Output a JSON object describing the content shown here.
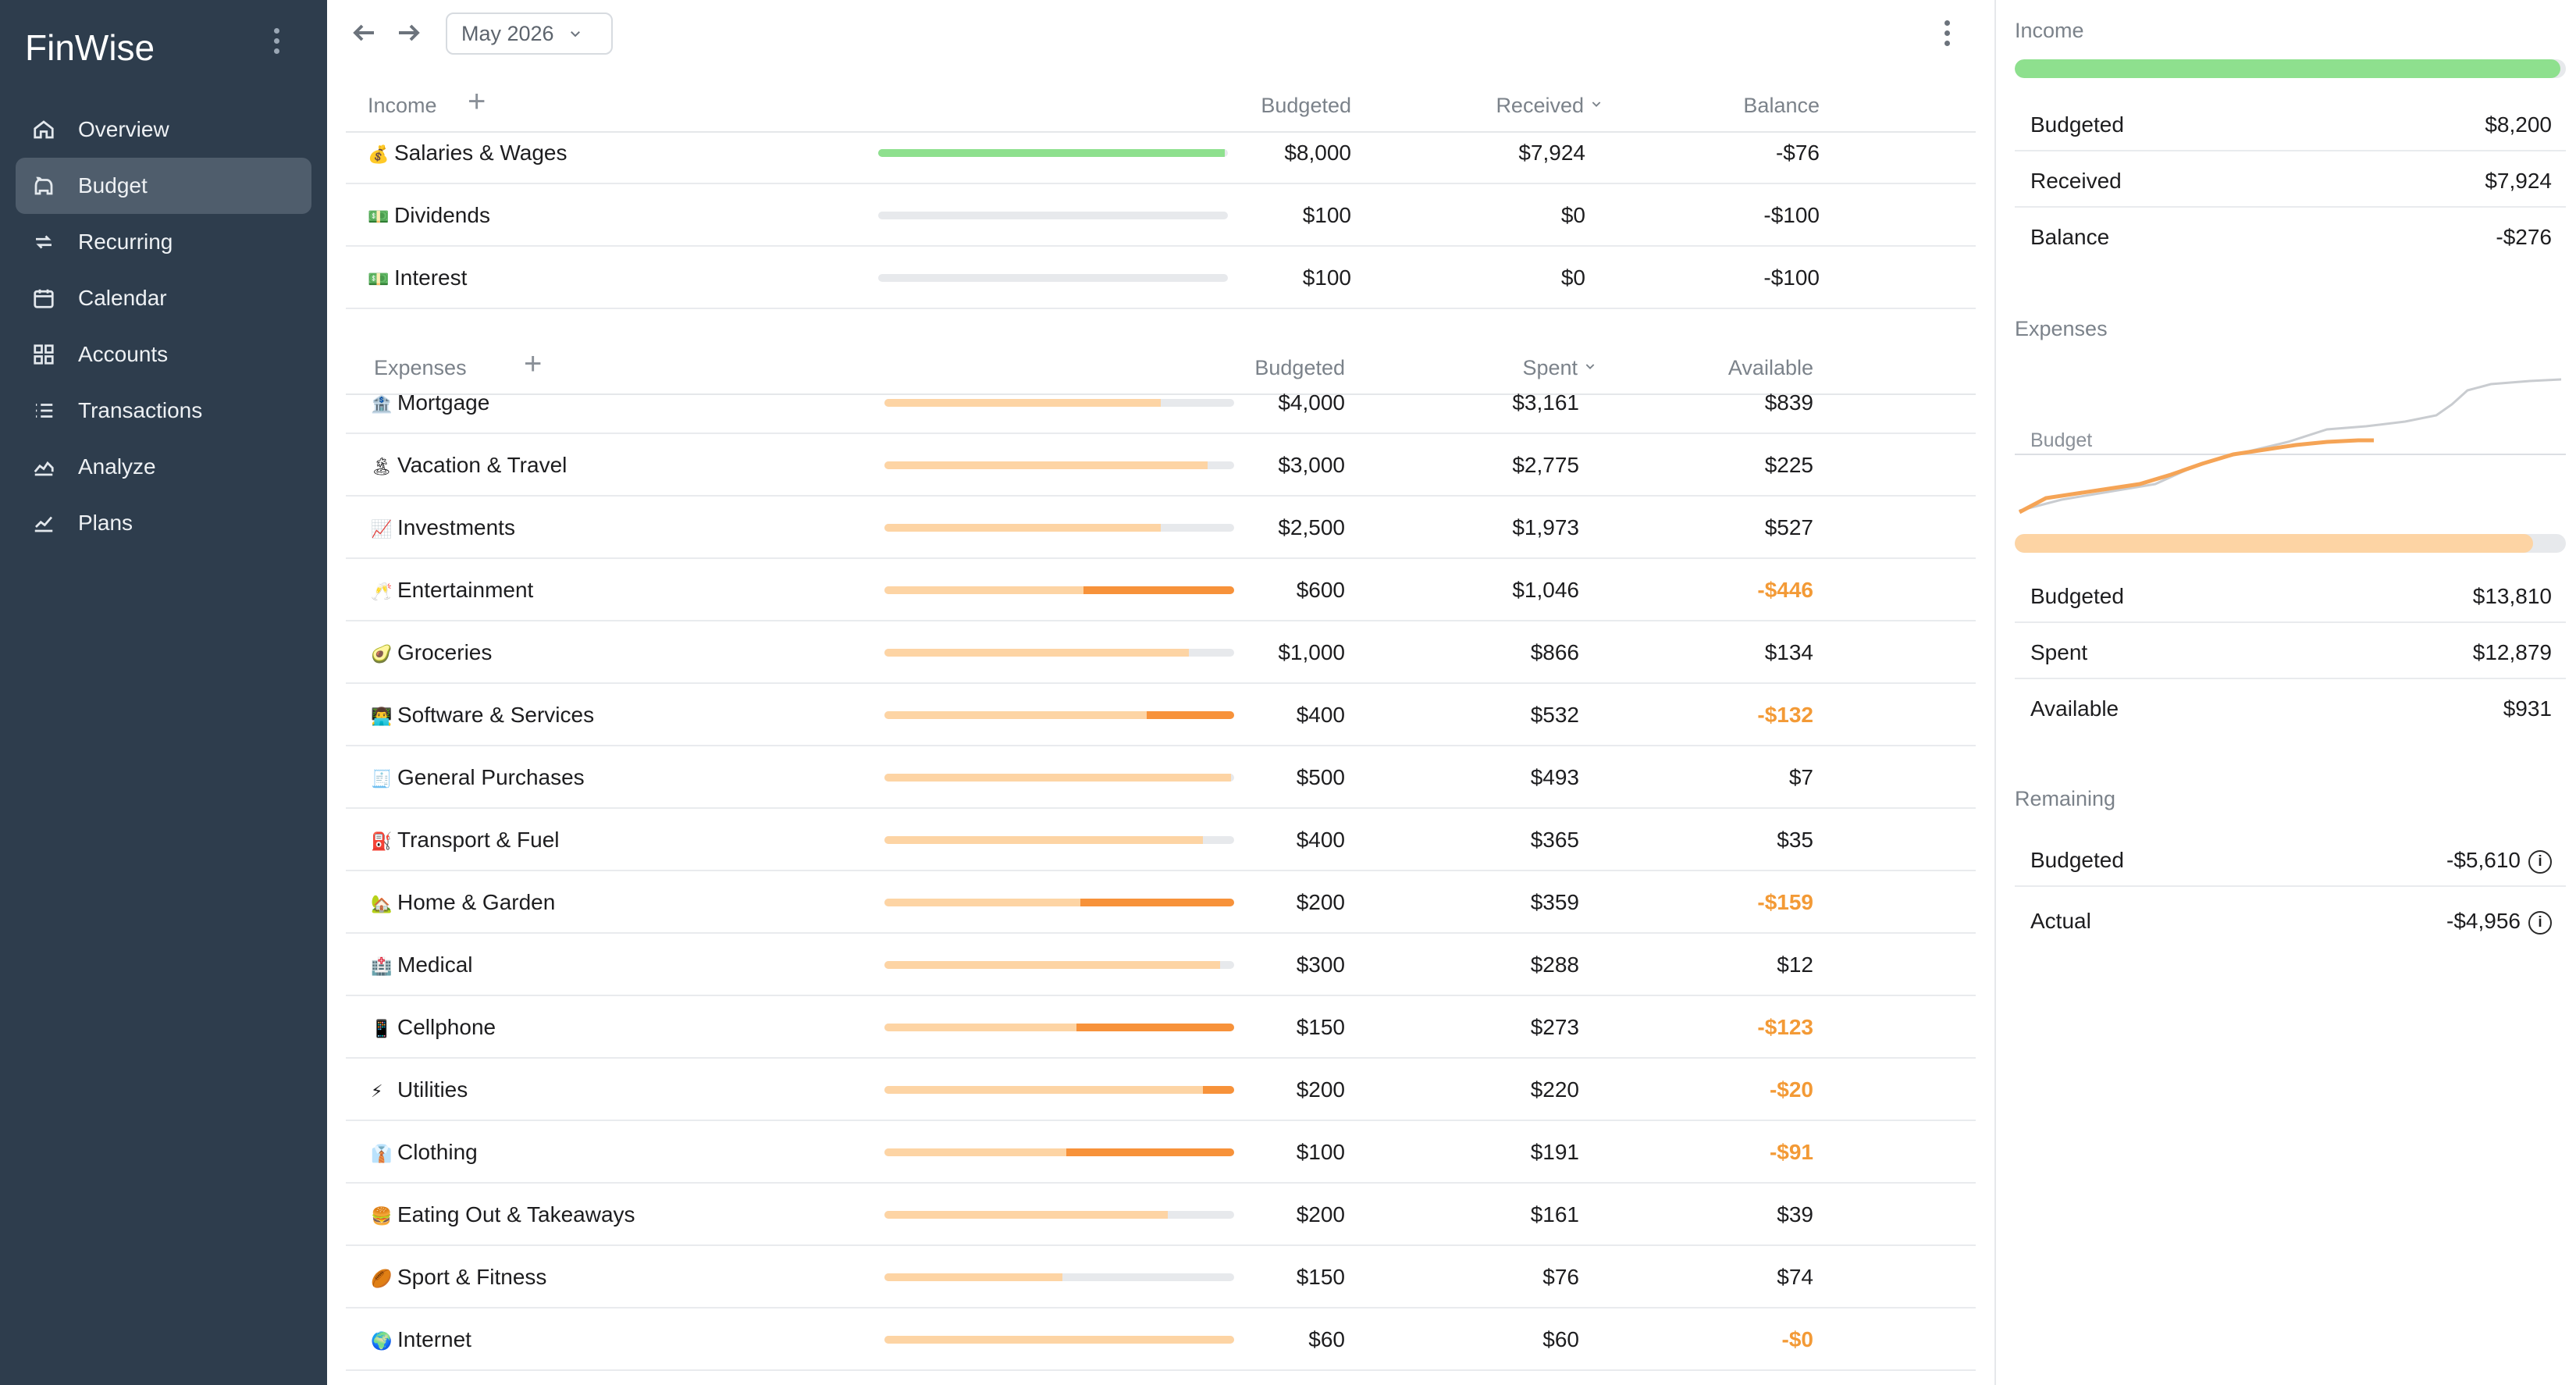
{
  "app": {
    "name": "FinWise",
    "nav": [
      {
        "label": "Overview",
        "icon": "home-icon"
      },
      {
        "label": "Budget",
        "icon": "piggy-bank-icon",
        "active": true
      },
      {
        "label": "Recurring",
        "icon": "repeat-icon"
      },
      {
        "label": "Calendar",
        "icon": "calendar-icon"
      },
      {
        "label": "Accounts",
        "icon": "grid-icon"
      },
      {
        "label": "Transactions",
        "icon": "list-icon"
      },
      {
        "label": "Analyze",
        "icon": "chart-area-icon"
      },
      {
        "label": "Plans",
        "icon": "chart-line-icon"
      }
    ]
  },
  "toolbar": {
    "month": "May 2026"
  },
  "income": {
    "label": "Income",
    "columns": [
      "Budgeted",
      "Received",
      "Balance"
    ],
    "rows": [
      {
        "emoji": "💰",
        "name": "Salaries & Wages",
        "budgeted": "$8,000",
        "received": "$7,924",
        "balance": "-$76",
        "progress": 0.99,
        "over": 0,
        "negative": false
      },
      {
        "emoji": "💵",
        "name": "Dividends",
        "budgeted": "$100",
        "received": "$0",
        "balance": "-$100",
        "progress": 0,
        "over": 0,
        "negative": false
      },
      {
        "emoji": "💵",
        "name": "Interest",
        "budgeted": "$100",
        "received": "$0",
        "balance": "-$100",
        "progress": 0,
        "over": 0,
        "negative": false
      }
    ]
  },
  "expenses": {
    "label": "Expenses",
    "columns": [
      "Budgeted",
      "Spent",
      "Available"
    ],
    "rows": [
      {
        "emoji": "🏦",
        "name": "Mortgage",
        "budgeted": "$4,000",
        "spent": "$3,161",
        "available": "$839",
        "progress": 0.79,
        "over": 0,
        "negative": false
      },
      {
        "emoji": "🏝",
        "name": "Vacation & Travel",
        "budgeted": "$3,000",
        "spent": "$2,775",
        "available": "$225",
        "progress": 0.925,
        "over": 0,
        "negative": false
      },
      {
        "emoji": "📈",
        "name": "Investments",
        "budgeted": "$2,500",
        "spent": "$1,973",
        "available": "$527",
        "progress": 0.79,
        "over": 0,
        "negative": false
      },
      {
        "emoji": "🥂",
        "name": "Entertainment",
        "budgeted": "$600",
        "spent": "$1,046",
        "available": "-$446",
        "progress": 0.57,
        "over": 0.43,
        "negative": true
      },
      {
        "emoji": "🥑",
        "name": "Groceries",
        "budgeted": "$1,000",
        "spent": "$866",
        "available": "$134",
        "progress": 0.87,
        "over": 0,
        "negative": false
      },
      {
        "emoji": "👨‍💻",
        "name": "Software & Services",
        "budgeted": "$400",
        "spent": "$532",
        "available": "-$132",
        "progress": 0.75,
        "over": 0.25,
        "negative": true
      },
      {
        "emoji": "🧾",
        "name": "General Purchases",
        "budgeted": "$500",
        "spent": "$493",
        "available": "$7",
        "progress": 0.99,
        "over": 0,
        "negative": false
      },
      {
        "emoji": "⛽",
        "name": "Transport & Fuel",
        "budgeted": "$400",
        "spent": "$365",
        "available": "$35",
        "progress": 0.91,
        "over": 0,
        "negative": false
      },
      {
        "emoji": "🏡",
        "name": "Home & Garden",
        "budgeted": "$200",
        "spent": "$359",
        "available": "-$159",
        "progress": 0.56,
        "over": 0.44,
        "negative": true
      },
      {
        "emoji": "🏥",
        "name": "Medical",
        "budgeted": "$300",
        "spent": "$288",
        "available": "$12",
        "progress": 0.96,
        "over": 0,
        "negative": false
      },
      {
        "emoji": "📱",
        "name": "Cellphone",
        "budgeted": "$150",
        "spent": "$273",
        "available": "-$123",
        "progress": 0.55,
        "over": 0.45,
        "negative": true
      },
      {
        "emoji": "⚡",
        "name": "Utilities",
        "budgeted": "$200",
        "spent": "$220",
        "available": "-$20",
        "progress": 0.91,
        "over": 0.09,
        "negative": true
      },
      {
        "emoji": "👔",
        "name": "Clothing",
        "budgeted": "$100",
        "spent": "$191",
        "available": "-$91",
        "progress": 0.52,
        "over": 0.48,
        "negative": true
      },
      {
        "emoji": "🍔",
        "name": "Eating Out & Takeaways",
        "budgeted": "$200",
        "spent": "$161",
        "available": "$39",
        "progress": 0.81,
        "over": 0,
        "negative": false
      },
      {
        "emoji": "🏉",
        "name": "Sport & Fitness",
        "budgeted": "$150",
        "spent": "$76",
        "available": "$74",
        "progress": 0.51,
        "over": 0,
        "negative": false
      },
      {
        "emoji": "🌍",
        "name": "Internet",
        "budgeted": "$60",
        "spent": "$60",
        "available": "-$0",
        "progress": 1.0,
        "over": 0,
        "negative": true
      }
    ]
  },
  "summary": {
    "income": {
      "title": "Income",
      "progress": 0.99,
      "rows": [
        {
          "label": "Budgeted",
          "value": "$8,200"
        },
        {
          "label": "Received",
          "value": "$7,924"
        },
        {
          "label": "Balance",
          "value": "-$276"
        }
      ]
    },
    "expenses": {
      "title": "Expenses",
      "chart_label": "Budget",
      "progress": 0.94,
      "rows": [
        {
          "label": "Budgeted",
          "value": "$13,810"
        },
        {
          "label": "Spent",
          "value": "$12,879"
        },
        {
          "label": "Available",
          "value": "$931"
        }
      ]
    },
    "remaining": {
      "title": "Remaining",
      "rows": [
        {
          "label": "Budgeted",
          "value": "-$5,610"
        },
        {
          "label": "Actual",
          "value": "-$4,956"
        }
      ]
    }
  },
  "colors": {
    "sidebar": "#2e3d4d",
    "income_fill": "#8ee08e",
    "expense_fill": "#fdd4a4",
    "over_fill": "#f7923a",
    "negative_text": "#f39a36",
    "expense_line": "#f5a456",
    "budget_line": "#c9ccd0"
  }
}
